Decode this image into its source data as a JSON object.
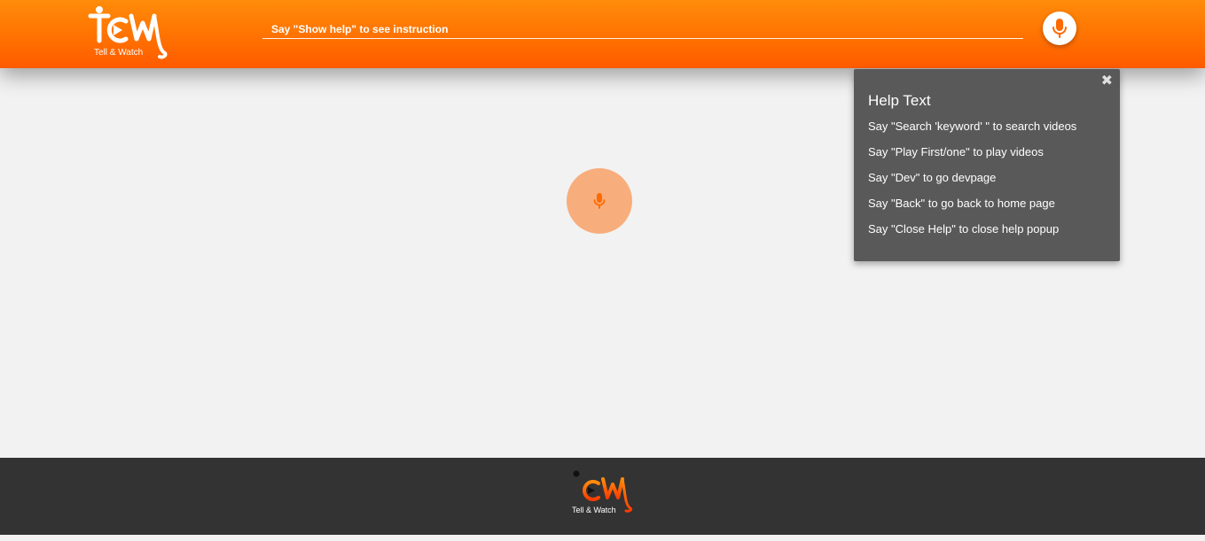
{
  "brand": {
    "logo_mark": "TCW",
    "logo_tagline": "Tell & Watch"
  },
  "header": {
    "search_hint": "Say \"Show help\" to see instruction",
    "mic_icon": "microphone-icon"
  },
  "main": {
    "mic_icon": "microphone-icon"
  },
  "help": {
    "title": "Help Text",
    "close_icon": "close-icon",
    "items": [
      "Say \"Search 'keyword' \" to search videos",
      "Say \"Play First/one\" to play videos",
      "Say \"Dev\" to go devpage",
      "Say \"Back\" to go back to home page",
      "Say \"Close Help\" to close help popup"
    ]
  },
  "colors": {
    "header_orange": "#ff6a00",
    "mic_orange": "#ff6a00",
    "center_mic_bg": "#f7ae7c",
    "popup_bg": "#595959",
    "footer_bg": "#333333",
    "page_bg": "#f2f2f2"
  }
}
